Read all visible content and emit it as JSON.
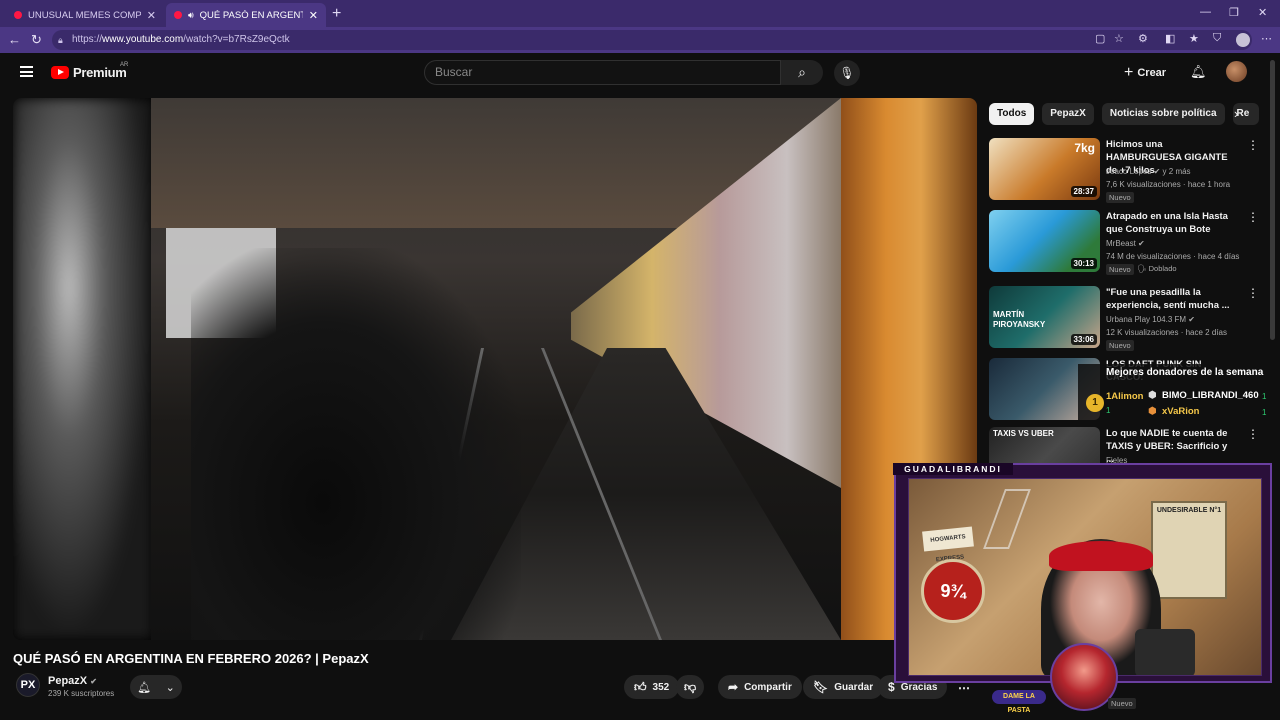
{
  "browser": {
    "tabs": [
      {
        "title": "UNUSUAL MEMES COMPILATION",
        "active": false
      },
      {
        "title": "QUÉ PASÓ EN ARGENTINA EN",
        "active": true
      }
    ],
    "url_prefix": "https://",
    "url_host": "www.youtube.com",
    "url_path": "/watch?v=b7RsZ9eQctk"
  },
  "header": {
    "logo_word": "Premium",
    "country_code": "AR",
    "search_placeholder": "Buscar",
    "create_label": "Crear"
  },
  "video": {
    "title": "QUÉ PASÓ EN ARGENTINA EN FEBRERO 2026? | PepazX",
    "channel": "PepazX",
    "channel_initials": "PX",
    "subscribers": "239 K suscriptores",
    "likes": "352",
    "share_label": "Compartir",
    "save_label": "Guardar",
    "thanks_label": "Gracias"
  },
  "chips": [
    "Todos",
    "PepazX",
    "Noticias sobre política",
    "Re"
  ],
  "recommendations": [
    {
      "title": "Hicimos una HAMBURGUESA GIGANTE de +7 kilos",
      "channel": "Joaco Lopez",
      "channel_extra": "y 2 más",
      "meta": "7,6 K visualizaciones · hace 1 hora",
      "badge": "Nuevo",
      "badge2": "",
      "duration": "28:37",
      "thumb_label": "7kg",
      "thumb_color": "#c97a2a"
    },
    {
      "title": "Atrapado en una Isla Hasta que Construya un Bote",
      "channel": "MrBeast",
      "channel_extra": "",
      "meta": "74 M de visualizaciones · hace 4 días",
      "badge": "Nuevo",
      "badge2": "Doblado",
      "duration": "30:13",
      "thumb_label": "",
      "thumb_color": "#2a9ad8"
    },
    {
      "title": "\"Fue una pesadilla la experiencia, sentí mucha ...",
      "channel": "Urbana Play 104.3 FM",
      "channel_extra": "",
      "meta": "12 K visualizaciones · hace 2 días",
      "badge": "Nuevo",
      "badge2": "",
      "duration": "33:06",
      "thumb_label": "MARTÍN PIROYANSKY",
      "thumb_color": "#1f6d6a"
    },
    {
      "title": "LOS DAFT PUNK SIN CASCO:",
      "channel": "",
      "channel_extra": "",
      "meta": "",
      "badge": "",
      "badge2": "",
      "duration": "",
      "thumb_label": "",
      "thumb_color": "#2a3a4a"
    },
    {
      "title": "Lo que NADIE te cuenta de TAXIS y UBER: Sacrificio y ...",
      "channel": "Fieles",
      "channel_extra": "",
      "meta": "",
      "badge": "",
      "badge2": "",
      "duration": "",
      "thumb_label": "TAXIS VS UBER",
      "thumb_color": "#3a3a3a"
    }
  ],
  "donors": {
    "title": "Mejores donadores de la semana",
    "left": [
      {
        "name": "1Alimon",
        "count": "1"
      }
    ],
    "right": [
      {
        "name": "BIMO_LIBRANDI_460",
        "count": "1"
      },
      {
        "name": "xVaRion",
        "count": "1"
      }
    ]
  },
  "stream": {
    "name": "GUADALIBRANDI",
    "poster_text": "UNDESIRABLE N°1",
    "platform_text": "9¾",
    "hogwarts_text": "HOGWARTS EXPRESS",
    "banner_text": "DAME LA PASTA",
    "new_badge": "Nuevo"
  }
}
